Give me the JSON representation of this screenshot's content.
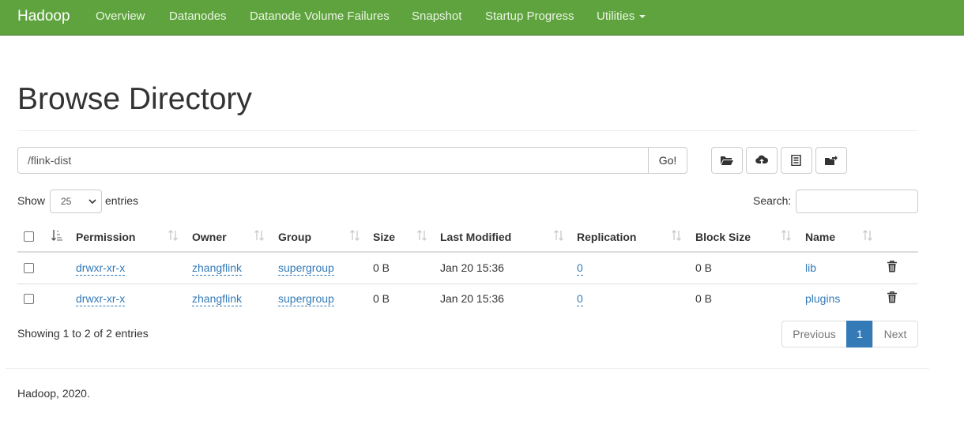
{
  "navbar": {
    "brand": "Hadoop",
    "items": [
      "Overview",
      "Datanodes",
      "Datanode Volume Failures",
      "Snapshot",
      "Startup Progress",
      "Utilities"
    ],
    "color": "#5fa33e"
  },
  "page": {
    "title": "Browse Directory"
  },
  "path_bar": {
    "value": "/flink-dist",
    "go_label": "Go!",
    "tools": [
      "create-directory-icon",
      "upload-icon",
      "cut-paste-icon",
      "move-icon"
    ]
  },
  "table_controls": {
    "show_label": "Show",
    "entries_label": "entries",
    "length_value": "25",
    "search_label": "Search:"
  },
  "table": {
    "headers": [
      "Permission",
      "Owner",
      "Group",
      "Size",
      "Last Modified",
      "Replication",
      "Block Size",
      "Name"
    ],
    "rows": [
      {
        "permission": "drwxr-xr-x",
        "owner": "zhangflink",
        "group": "supergroup",
        "size": "0 B",
        "last_modified": "Jan 20 15:36",
        "replication": "0",
        "block_size": "0 B",
        "name": "lib"
      },
      {
        "permission": "drwxr-xr-x",
        "owner": "zhangflink",
        "group": "supergroup",
        "size": "0 B",
        "last_modified": "Jan 20 15:36",
        "replication": "0",
        "block_size": "0 B",
        "name": "plugins"
      }
    ]
  },
  "table_info": "Showing 1 to 2 of 2 entries",
  "pagination": {
    "previous": "Previous",
    "current": "1",
    "next": "Next"
  },
  "footer": "Hadoop, 2020.",
  "colors": {
    "link": "#337ab7",
    "active_page": "#337ab7"
  }
}
